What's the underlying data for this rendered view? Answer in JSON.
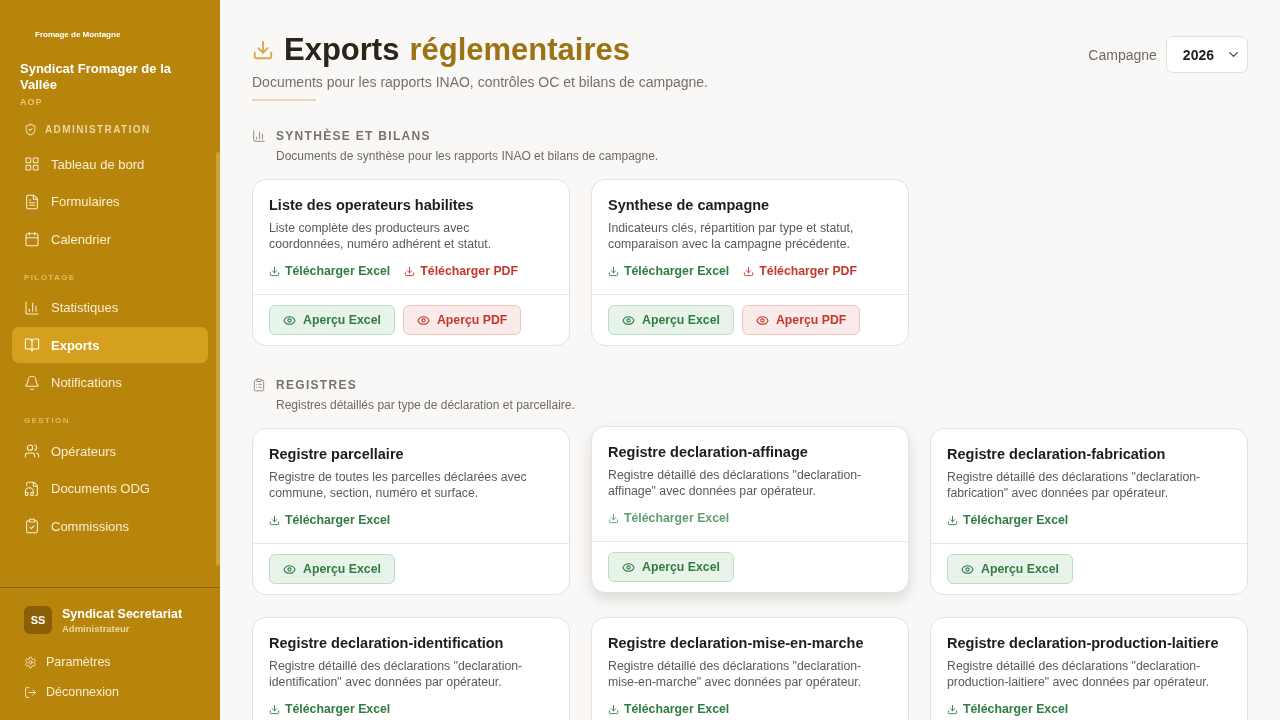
{
  "sidebar": {
    "brand_tag": "Fromage de Montagne",
    "org_name": "Syndicat Fromager de la Vallée",
    "org_type": "AOP",
    "sections": [
      {
        "title": "ADMINISTRATION",
        "kind": "role",
        "items": [
          {
            "label": "Tableau de bord",
            "selected": false
          },
          {
            "label": "Formulaires",
            "selected": false
          },
          {
            "label": "Calendrier",
            "selected": false
          }
        ]
      },
      {
        "title": "PILOTAGE",
        "kind": "group",
        "items": [
          {
            "label": "Statistiques",
            "selected": false
          },
          {
            "label": "Exports",
            "selected": true
          },
          {
            "label": "Notifications",
            "selected": false
          }
        ]
      },
      {
        "title": "GESTION",
        "kind": "group",
        "items": [
          {
            "label": "Opérateurs",
            "selected": false
          },
          {
            "label": "Documents ODG",
            "selected": false
          },
          {
            "label": "Commissions",
            "selected": false
          }
        ]
      }
    ],
    "user": {
      "initials": "SS",
      "name": "Syndicat Secretariat",
      "role": "Administrateur"
    },
    "footer_links": [
      "Paramètres",
      "Déconnexion"
    ]
  },
  "header": {
    "title_main": "Exports",
    "title_accent": "réglementaires",
    "subtitle": "Documents pour les rapports INAO, contrôles OC et bilans de campagne.",
    "campaign_label": "Campagne",
    "campaign_value": "2026"
  },
  "sections": [
    {
      "title": "SYNTHÈSE ET BILANS",
      "description": "Documents de synthèse pour les rapports INAO et bilans de campagne.",
      "cards": [
        {
          "title": "Liste des operateurs habilites",
          "description": "Liste complète des producteurs avec coordonnées, numéro adhérent et statut.",
          "hovered": false,
          "downloads": [
            {
              "label": "Télécharger Excel",
              "kind": "excel"
            },
            {
              "label": "Télécharger PDF",
              "kind": "pdf"
            }
          ],
          "previews": [
            {
              "label": "Aperçu Excel",
              "kind": "excel"
            },
            {
              "label": "Aperçu PDF",
              "kind": "pdf"
            }
          ]
        },
        {
          "title": "Synthese de campagne",
          "description": "Indicateurs clés, répartition par type et statut, comparaison avec la campagne précédente.",
          "hovered": false,
          "downloads": [
            {
              "label": "Télécharger Excel",
              "kind": "excel"
            },
            {
              "label": "Télécharger PDF",
              "kind": "pdf"
            }
          ],
          "previews": [
            {
              "label": "Aperçu Excel",
              "kind": "excel"
            },
            {
              "label": "Aperçu PDF",
              "kind": "pdf"
            }
          ]
        }
      ]
    },
    {
      "title": "REGISTRES",
      "description": "Registres détaillés par type de déclaration et parcellaire.",
      "cards": [
        {
          "title": "Registre parcellaire",
          "description": "Registre de toutes les parcelles déclarées avec commune, section, numéro et surface.",
          "hovered": false,
          "downloads": [
            {
              "label": "Télécharger Excel",
              "kind": "excel"
            }
          ],
          "previews": [
            {
              "label": "Aperçu Excel",
              "kind": "excel"
            }
          ]
        },
        {
          "title": "Registre declaration-affinage",
          "description": "Registre détaillé des déclarations \"declaration-affinage\" avec données par opérateur.",
          "hovered": true,
          "downloads": [
            {
              "label": "Télécharger Excel",
              "kind": "excel"
            }
          ],
          "previews": [
            {
              "label": "Aperçu Excel",
              "kind": "excel"
            }
          ]
        },
        {
          "title": "Registre declaration-fabrication",
          "description": "Registre détaillé des déclarations \"declaration-fabrication\" avec données par opérateur.",
          "hovered": false,
          "downloads": [
            {
              "label": "Télécharger Excel",
              "kind": "excel"
            }
          ],
          "previews": [
            {
              "label": "Aperçu Excel",
              "kind": "excel"
            }
          ]
        },
        {
          "title": "Registre declaration-identification",
          "description": "Registre détaillé des déclarations \"declaration-identification\" avec données par opérateur.",
          "hovered": false,
          "downloads": [
            {
              "label": "Télécharger Excel",
              "kind": "excel"
            }
          ]
        },
        {
          "title": "Registre declaration-mise-en-marche",
          "description": "Registre détaillé des déclarations \"declaration-mise-en-marche\" avec données par opérateur.",
          "hovered": false,
          "downloads": [
            {
              "label": "Télécharger Excel",
              "kind": "excel"
            }
          ]
        },
        {
          "title": "Registre declaration-production-laitiere",
          "description": "Registre détaillé des déclarations \"declaration-production-laitiere\" avec données par opérateur.",
          "hovered": false,
          "downloads": [
            {
              "label": "Télécharger Excel",
              "kind": "excel"
            }
          ]
        }
      ]
    }
  ]
}
